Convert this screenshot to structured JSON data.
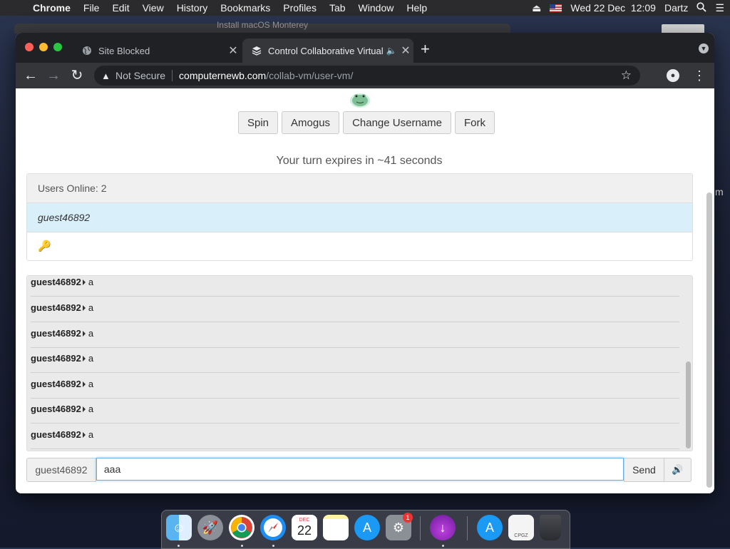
{
  "menubar": {
    "apple": "",
    "app": "Chrome",
    "menus": [
      "File",
      "Edit",
      "View",
      "History",
      "Bookmarks",
      "Profiles",
      "Tab",
      "Window",
      "Help"
    ],
    "datetime": "Wed 22 Dec  12:09",
    "user": "Dartz"
  },
  "background": {
    "window_title": "Install macOS Monterey",
    "side_letter": "m"
  },
  "browser": {
    "tabs": [
      {
        "title": "Site Blocked",
        "active": false
      },
      {
        "title": "Control Collaborative Virtual Machines!",
        "active": true
      }
    ],
    "address": {
      "security": "Not Secure",
      "host": "computernewb.com",
      "path": "/collab-vm/user-vm/"
    }
  },
  "page": {
    "buttons": [
      "Spin",
      "Amogus",
      "Change Username",
      "Fork"
    ],
    "turn_text": "Your turn expires in ~41 seconds",
    "users": {
      "header": "Users Online: 2",
      "list": [
        "guest46892",
        "🔑"
      ]
    },
    "chat": {
      "messages": [
        {
          "user": "guest46892",
          "text": "a"
        },
        {
          "user": "guest46892",
          "text": "a"
        },
        {
          "user": "guest46892",
          "text": "a"
        },
        {
          "user": "guest46892",
          "text": "a"
        },
        {
          "user": "guest46892",
          "text": "a"
        },
        {
          "user": "guest46892",
          "text": "a"
        },
        {
          "user": "guest46892",
          "text": "a"
        }
      ]
    },
    "input": {
      "username": "guest46892",
      "value": "aaa",
      "send": "Send",
      "volume_icon": "🔊"
    }
  },
  "dock": {
    "calendar_month": "DEC",
    "calendar_day": "22",
    "settings_badge": "1",
    "archive_label": "CPGZ",
    "items": [
      "finder-icon",
      "launchpad-icon",
      "chrome-icon",
      "safari-icon",
      "calendar-icon",
      "notes-icon",
      "app-store-icon",
      "system-preferences-icon",
      "downloads-icon",
      "app-store-icon",
      "archive-icon",
      "trash-icon"
    ]
  },
  "colors": {
    "tab_bar": "#202124",
    "toolbar": "#35363a",
    "active_user_bg": "#d9f0fa",
    "input_focus": "#66afe9"
  }
}
